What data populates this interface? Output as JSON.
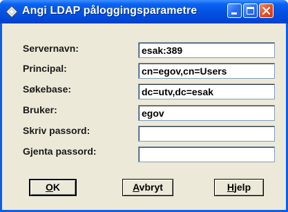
{
  "window": {
    "title": "Angi LDAP påloggingsparametre",
    "accent": "#0a5ee8"
  },
  "titlebar_buttons": {
    "minimize_icon": "minimize-icon",
    "maximize_icon": "maximize-icon",
    "close_icon": "close-icon"
  },
  "form": {
    "fields": [
      {
        "label": "Servernavn:",
        "value": "esak:389"
      },
      {
        "label": "Principal:",
        "value": "cn=egov,cn=Users"
      },
      {
        "label": "Søkebase:",
        "value": "dc=utv,dc=esak"
      },
      {
        "label": "Bruker:",
        "value": "egov"
      },
      {
        "label": "Skriv passord:",
        "value": ""
      },
      {
        "label": "Gjenta passord:",
        "value": ""
      }
    ]
  },
  "buttons": {
    "ok": {
      "mnemonic": "O",
      "rest": "K"
    },
    "cancel": {
      "mnemonic": "A",
      "rest": "vbryt"
    },
    "help": {
      "mnemonic": "H",
      "rest": "jelp"
    }
  }
}
